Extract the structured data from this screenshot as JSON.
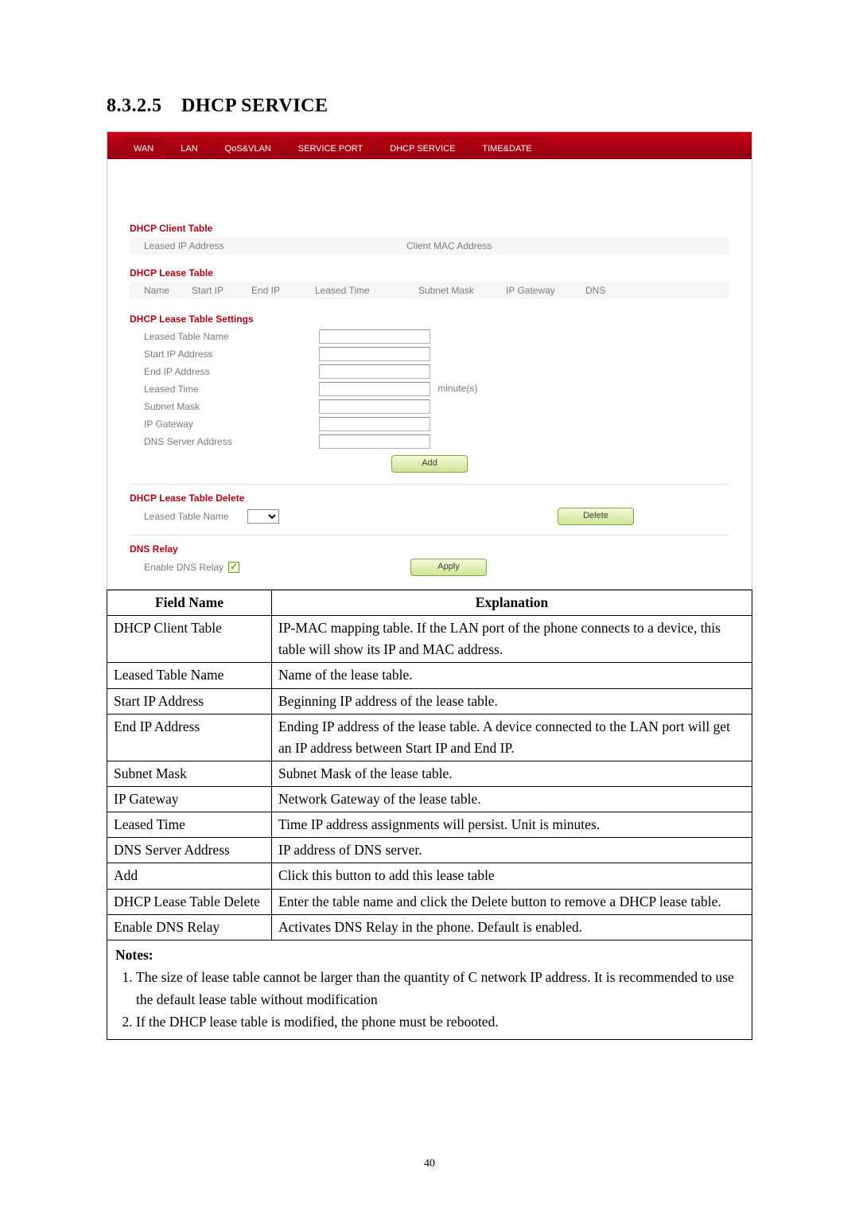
{
  "heading": {
    "number": "8.3.2.5",
    "title": "DHCP SERVICE"
  },
  "tabs": [
    "WAN",
    "LAN",
    "QoS&VLAN",
    "SERVICE PORT",
    "DHCP SERVICE",
    "TIME&DATE"
  ],
  "tabs_active_index": 0,
  "client_table": {
    "title": "DHCP Client Table",
    "cols": [
      "Leased IP Address",
      "Client MAC Address"
    ]
  },
  "lease_table": {
    "title": "DHCP Lease Table",
    "cols": [
      "Name",
      "Start IP",
      "End IP",
      "Leased Time",
      "Subnet Mask",
      "IP Gateway",
      "DNS"
    ]
  },
  "settings": {
    "title": "DHCP Lease Table Settings",
    "fields": {
      "leased_table_name": "Leased Table Name",
      "start_ip": "Start IP Address",
      "end_ip": "End IP Address",
      "leased_time": "Leased Time",
      "leased_time_unit": "minute(s)",
      "subnet_mask": "Subnet Mask",
      "ip_gateway": "IP Gateway",
      "dns_server": "DNS Server Address"
    },
    "add_btn": "Add"
  },
  "delete": {
    "title": "DHCP Lease Table Delete",
    "label": "Leased Table Name",
    "btn": "Delete"
  },
  "dns_relay": {
    "title": "DNS Relay",
    "label": "Enable DNS Relay",
    "checked": true,
    "apply_btn": "Apply"
  },
  "desc_table": {
    "headers": [
      "Field Name",
      "Explanation"
    ],
    "rows": [
      [
        "DHCP Client Table",
        "IP-MAC mapping table. If the LAN port of the phone connects to a device, this table will show its IP and MAC address."
      ],
      [
        "Leased Table Name",
        "Name of the lease table."
      ],
      [
        "Start IP Address",
        "Beginning IP address of the lease table."
      ],
      [
        "End IP Address",
        "Ending IP address of the lease table.    A device connected to the LAN port will get an IP address between Start IP and End IP."
      ],
      [
        "Subnet Mask",
        "Subnet Mask of the lease table."
      ],
      [
        "IP Gateway",
        "Network Gateway of the lease table."
      ],
      [
        "Leased Time",
        "Time IP address assignments will persist. Unit is minutes."
      ],
      [
        "DNS Server Address",
        "IP address of DNS server."
      ],
      [
        "Add",
        "Click this button to add this lease table"
      ],
      [
        "DHCP Lease Table Delete",
        "Enter the table name and click the Delete button to remove a DHCP lease table."
      ],
      [
        "Enable DNS Relay",
        "Activates DNS Relay in the phone.    Default is enabled."
      ]
    ]
  },
  "notes": {
    "title": "Notes:",
    "items": [
      "The size of lease table cannot be larger than the quantity of C network IP address. It is recommended to use the default lease table without modification",
      "If the DHCP lease table is modified, the phone must be rebooted."
    ]
  },
  "page_number": "40"
}
